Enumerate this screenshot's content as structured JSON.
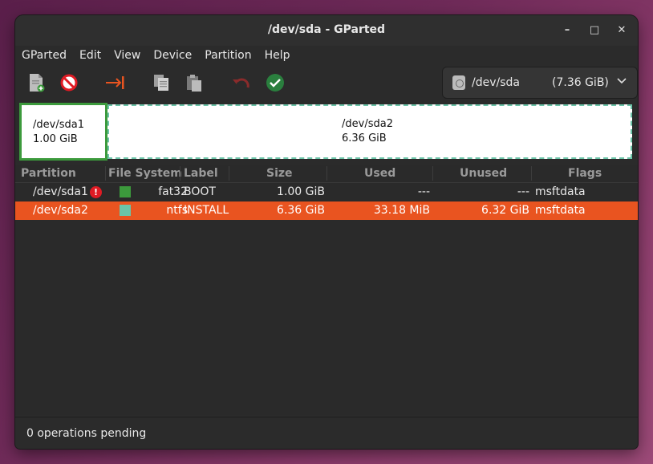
{
  "window": {
    "title": "/dev/sda - GParted",
    "minimize_glyph": "–",
    "maximize_glyph": "□",
    "close_glyph": "✕"
  },
  "menu": [
    "GParted",
    "Edit",
    "View",
    "Device",
    "Partition",
    "Help"
  ],
  "toolbar": {
    "icons": [
      "new-partition-icon",
      "delete-icon",
      "resize-move-icon",
      "copy-icon",
      "paste-icon",
      "undo-icon",
      "apply-icon"
    ]
  },
  "device_selector": {
    "device": "/dev/sda",
    "size": "(7.36 GiB)"
  },
  "partition_map": [
    {
      "name": "/dev/sda1",
      "size": "1.00 GiB"
    },
    {
      "name": "/dev/sda2",
      "size": "6.36 GiB"
    }
  ],
  "columns": [
    "Partition",
    "File System",
    "Label",
    "Size",
    "Used",
    "Unused",
    "Flags"
  ],
  "rows": [
    {
      "partition": "/dev/sda1",
      "fs": "fat32",
      "label": "BOOT",
      "size": "1.00 GiB",
      "used": "---",
      "unused": "---",
      "flags": "msftdata",
      "color": "#3c9a3c",
      "warning": "!"
    },
    {
      "partition": "/dev/sda2",
      "fs": "ntfs",
      "label": "INSTALL",
      "size": "6.36 GiB",
      "used": "33.18 MiB",
      "unused": "6.32 GiB",
      "flags": "msftdata",
      "color": "#6bc4a8"
    }
  ],
  "status": "0 operations pending",
  "colors": {
    "accent": "#e95420",
    "fat32": "#3c9a3c",
    "ntfs": "#6bc4a8"
  }
}
